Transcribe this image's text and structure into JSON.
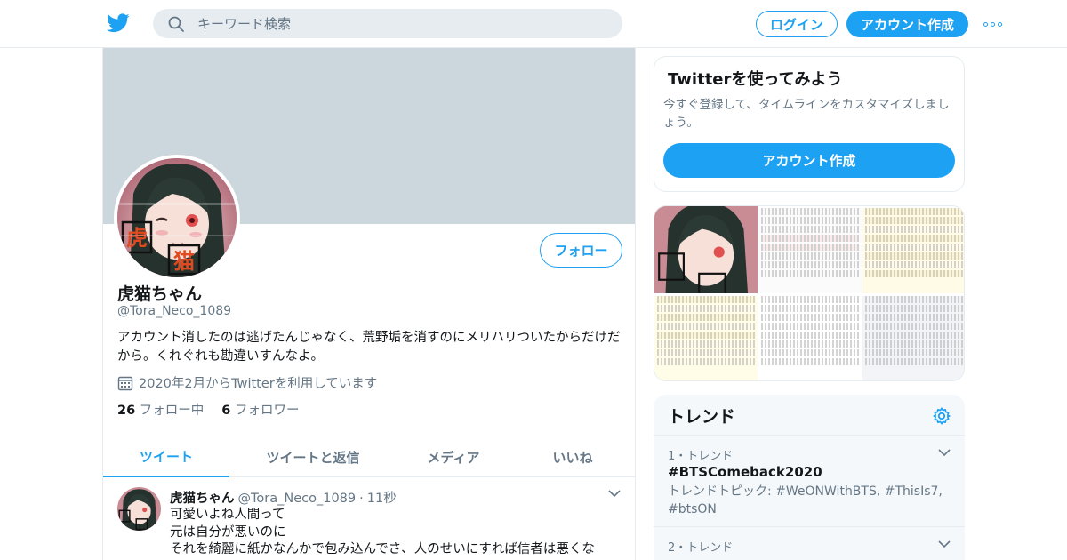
{
  "header": {
    "search_placeholder": "キーワード検索",
    "login_label": "ログイン",
    "signup_label": "アカウント作成"
  },
  "profile": {
    "name": "虎猫ちゃん",
    "handle": "@Tora_Neco_1089",
    "bio": "アカウント消したのは逃げたんじゃなく、荒野垢を消すのにメリハリついたからだけだから。くれぐれも勘違いすんなよ。",
    "joined": "2020年2月からTwitterを利用しています",
    "following_count": "26",
    "following_label": "フォロー中",
    "followers_count": "6",
    "followers_label": "フォロワー",
    "follow_button": "フォロー",
    "avatar_text": "虎猫"
  },
  "tabs": [
    {
      "label": "ツイート",
      "active": true
    },
    {
      "label": "ツイートと返信"
    },
    {
      "label": "メディア"
    },
    {
      "label": "いいね"
    }
  ],
  "tweet": {
    "name": "虎猫ちゃん",
    "handle": "@Tora_Neco_1089",
    "separator": "·",
    "time": "11秒",
    "lines": [
      "可愛いよね人間って",
      "元は自分が悪いのに",
      "それを綺麗に紙かなんかで包み込んでさ、人のせいにすれば信者は悪くな"
    ]
  },
  "signup_card": {
    "title": "Twitterを使ってみよう",
    "text": "今すぐ登録して、タイムラインをカスタマイズしましょう。",
    "button": "アカウント作成"
  },
  "trends": {
    "title": "トレンド",
    "items": [
      {
        "meta": "1・トレンド",
        "name": "#BTSComeback2020",
        "desc": "トレンドトピック: #WeONWithBTS, #ThisIs7, #btsON"
      },
      {
        "meta": "2・トレンド",
        "name": "",
        "desc": ""
      }
    ]
  },
  "colors": {
    "accent": "#1da1f2",
    "banner": "#ccd6dd",
    "secondary_text": "#657786",
    "border": "#e6ecf0"
  },
  "icons": [
    "twitter-logo-icon",
    "search-icon",
    "more-icon",
    "calendar-icon",
    "chevron-down-icon",
    "gear-icon"
  ]
}
